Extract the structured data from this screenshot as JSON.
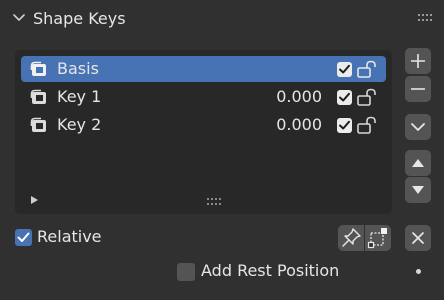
{
  "panel": {
    "title": "Shape Keys",
    "expanded": true
  },
  "shape_keys": [
    {
      "name": "Basis",
      "value": "",
      "enabled": true,
      "locked": false,
      "selected": true
    },
    {
      "name": "Key 1",
      "value": "0.000",
      "enabled": true,
      "locked": false,
      "selected": false
    },
    {
      "name": "Key 2",
      "value": "0.000",
      "enabled": true,
      "locked": false,
      "selected": false
    }
  ],
  "side_buttons": {
    "add_icon": "plus-icon",
    "remove_icon": "minus-icon",
    "specials_icon": "chevron-down-icon",
    "move_up_icon": "triangle-up-icon",
    "move_down_icon": "triangle-down-icon",
    "clear_icon": "x-icon"
  },
  "options": {
    "relative_label": "Relative",
    "relative_checked": true,
    "add_rest_position_label": "Add Rest Position",
    "add_rest_position_checked": false
  },
  "colors": {
    "panel_bg": "#303030",
    "list_bg": "#282828",
    "selection": "#4772b3",
    "button_bg": "#545454",
    "text": "#e6e6e6"
  }
}
